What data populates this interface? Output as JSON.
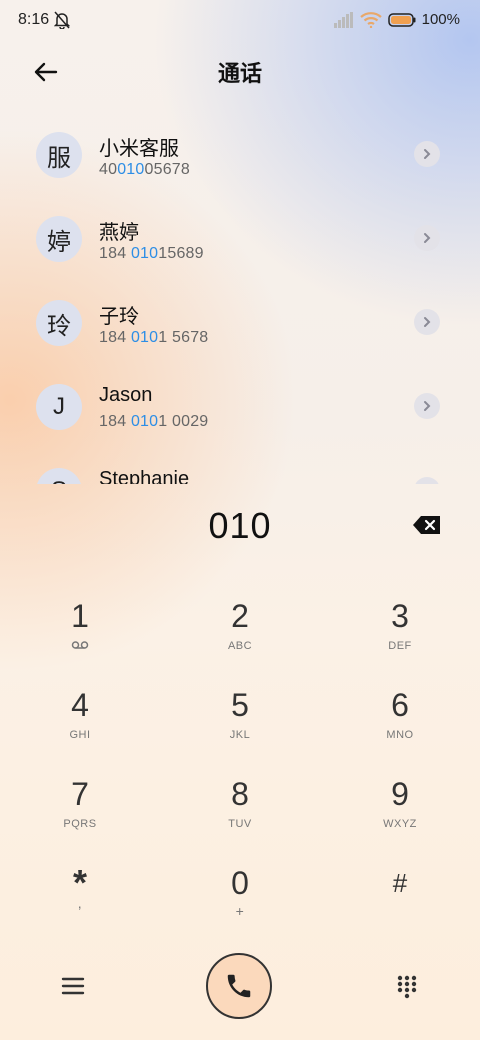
{
  "status_bar": {
    "time": "8:16",
    "battery": "100%"
  },
  "header": {
    "title": "通话"
  },
  "contacts": [
    {
      "avatar": "服",
      "name": "小米客服",
      "num_pre": "40",
      "num_hl": "010",
      "num_post": "05678"
    },
    {
      "avatar": "婷",
      "name": "燕婷",
      "num_pre": "184 ",
      "num_hl": "010",
      "num_post": "15689"
    },
    {
      "avatar": "玲",
      "name": "子玲",
      "num_pre": "184 ",
      "num_hl": "010",
      "num_post": "1 5678"
    },
    {
      "avatar": "J",
      "name": "Jason",
      "num_pre": "184 ",
      "num_hl": "010",
      "num_post": "1 0029"
    },
    {
      "avatar": "S",
      "name": "Stephanie",
      "num_pre": "",
      "num_hl": "",
      "num_post": ""
    }
  ],
  "dialed_number": "010",
  "keypad": [
    {
      "digit": "1",
      "sub": ""
    },
    {
      "digit": "2",
      "sub": "ABC"
    },
    {
      "digit": "3",
      "sub": "DEF"
    },
    {
      "digit": "4",
      "sub": "GHI"
    },
    {
      "digit": "5",
      "sub": "JKL"
    },
    {
      "digit": "6",
      "sub": "MNO"
    },
    {
      "digit": "7",
      "sub": "PQRS"
    },
    {
      "digit": "8",
      "sub": "TUV"
    },
    {
      "digit": "9",
      "sub": "WXYZ"
    },
    {
      "digit": "*",
      "sub": ","
    },
    {
      "digit": "0",
      "sub": "+"
    },
    {
      "digit": "#",
      "sub": ""
    }
  ],
  "icons": {
    "voicemail": "voicemail-icon",
    "call": "phone-icon",
    "menu": "menu-icon",
    "keypad": "dialpad-icon",
    "delete": "backspace-icon"
  },
  "colors": {
    "highlight": "#2d8ee6",
    "call_button": "#fbd9bc"
  }
}
